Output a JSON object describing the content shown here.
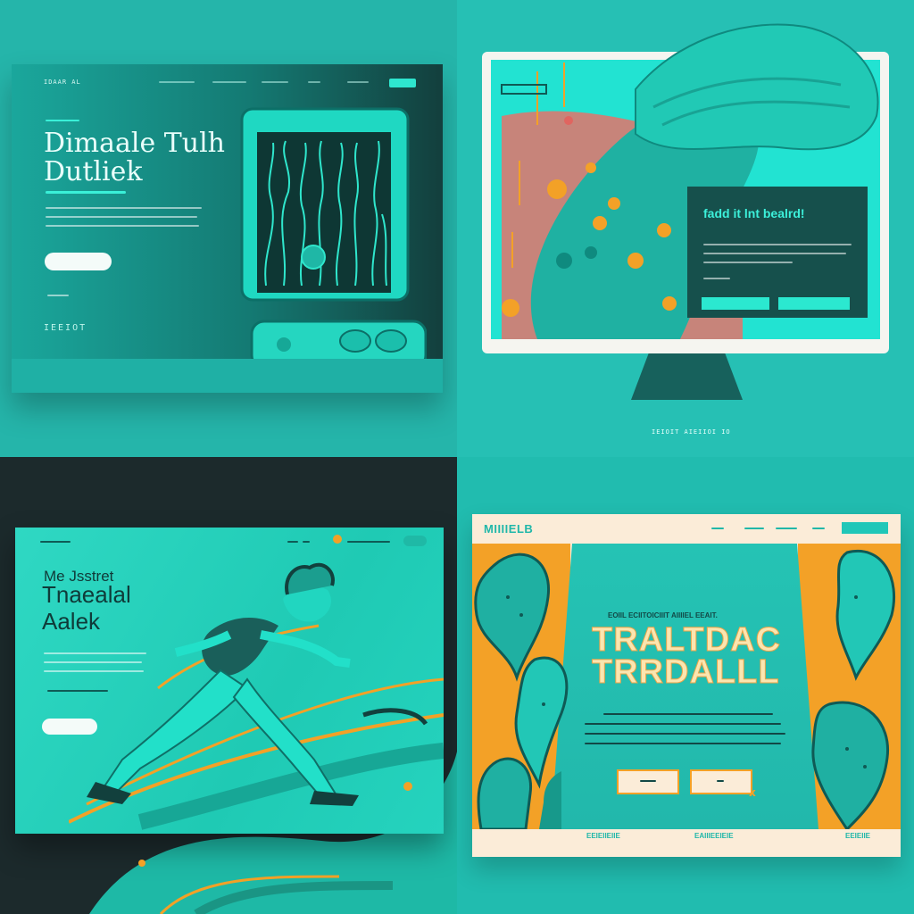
{
  "colors": {
    "teal_bg": "#25b8ad",
    "dark_teal": "#13514f",
    "mint": "#2ee6cf",
    "orange": "#f3a127",
    "coral": "#e66b60",
    "cream": "#fbecd8",
    "charcoal": "#1c2a2c"
  },
  "panel_tl": {
    "logo": "IDAAR AL",
    "nav_button": "",
    "heading_line1": "Dimaale Tulh",
    "heading_line2": "Dutliek",
    "cta": "",
    "footer_word": "IEEIOT",
    "icons": [
      "tablet-device",
      "flame-pattern",
      "knob-left",
      "knob-right"
    ]
  },
  "panel_tr": {
    "card_title": "fadd it lnt bealrd!",
    "caption": "IEIOIT AIEIIOI IO",
    "icons": [
      "monitor",
      "liquid-wave",
      "orange-bubble"
    ]
  },
  "panel_bl": {
    "kicker": "Me Jsstret",
    "heading_line1": "Tnaealal",
    "heading_line2": "Aalek",
    "cta": "",
    "icons": [
      "runner-figure",
      "speed-line"
    ]
  },
  "panel_br": {
    "logo": "MIIIIELB",
    "eyebrow": "EOIIL ECIITOICIIIT AIIIIEL EEAIT.",
    "heading_line1": "TRALTDAC",
    "heading_line2": "TRRDALLL",
    "footer_left": "EEIEIIEIIE",
    "footer_mid": "EAIIIEEIEIE",
    "footer_right": "EEIEIIE",
    "icons": [
      "teal-blob",
      "bottle",
      "sparkle"
    ]
  }
}
